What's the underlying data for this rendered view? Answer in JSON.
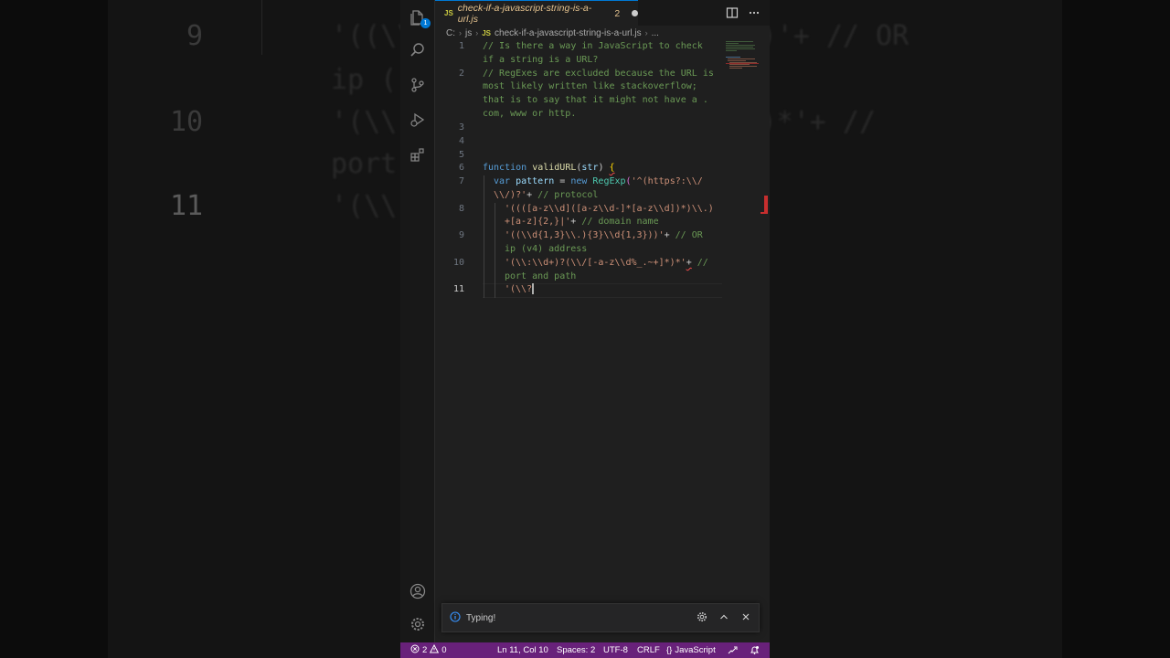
{
  "background": {
    "lines": [
      {
        "num": "9",
        "text": "'((\\\\                    })'+ // OR"
      },
      {
        "num": "",
        "text": "ip ("
      },
      {
        "num": "10",
        "text": "'(\\\\                 .~+]*)*'+ //"
      },
      {
        "num": "",
        "text": "port"
      },
      {
        "num": "11",
        "text": "'(\\\\"
      }
    ]
  },
  "tab": {
    "lang_badge": "JS",
    "filename": "check-if-a-javascript-string-is-a-url.js",
    "problems": "2"
  },
  "breadcrumb": {
    "drive": "C:",
    "folder": "js",
    "lang_badge": "JS",
    "file": "check-if-a-javascript-string-is-a-url.js",
    "more": "..."
  },
  "activity": {
    "explorer_badge": "1"
  },
  "editor": {
    "line_numbers": [
      "1",
      "2",
      "3",
      "4",
      "5",
      "6",
      "7",
      "8",
      "9",
      "10",
      "11"
    ],
    "lines": {
      "l1a": "// Is there a way in JavaScript to check",
      "l1b": "if a string is a URL?",
      "l2a": "// RegExes are excluded because the URL is",
      "l2b": "most likely written like stackoverflow;",
      "l2c": "that is to say that it might not have a .",
      "l2d": "com, www or http.",
      "l6_kw": "function",
      "l6_fn": "validURL",
      "l6_p1": "(",
      "l6_arg": "str",
      "l6_p2": ")",
      "l6_br": "{",
      "l7_kw": "var",
      "l7_var": "pattern",
      "l7_eq": " = ",
      "l7_new": "new",
      "l7_cls": "RegExp",
      "l7_br": "(",
      "l7_str_a": "'^(https?:\\\\/",
      "l7_str_b": "\\\\/)?'",
      "l7_plus": "+ ",
      "l7_cm": "// protocol",
      "l8_str_a": "'((([a-z\\\\d]([a-z\\\\d-]*[a-z\\\\d])*)\\\\.)",
      "l8_str_b": "+[a-z]{2,}|'",
      "l8_plus": "+ ",
      "l8_cm": "// domain name",
      "l9_str": "'((\\\\d{1,3}\\\\.){3}\\\\d{1,3}))'",
      "l9_plus": "+ ",
      "l9_cm_a": "// OR",
      "l9_cm_b": "ip (v4) address",
      "l10_str": "'(\\\\:\\\\d+)?(\\\\/[-a-z\\\\d%_.~+]*)*'",
      "l10_plus": "+",
      "l10_cm_a": " //",
      "l10_cm_b": "port and path",
      "l11_str": "'(\\\\?"
    }
  },
  "notification": {
    "text": "Typing!"
  },
  "statusbar": {
    "errors": "2",
    "warnings": "0",
    "position": "Ln 11, Col 10",
    "spaces": "Spaces: 2",
    "encoding": "UTF-8",
    "eol": "CRLF",
    "language_icon": "{}",
    "language": "JavaScript"
  },
  "colors": {
    "statusbar": "#68217a",
    "comment": "#6a9955",
    "string": "#ce9178",
    "keyword": "#569cd6",
    "function": "#dcdcaa",
    "error": "#f14c4c"
  }
}
